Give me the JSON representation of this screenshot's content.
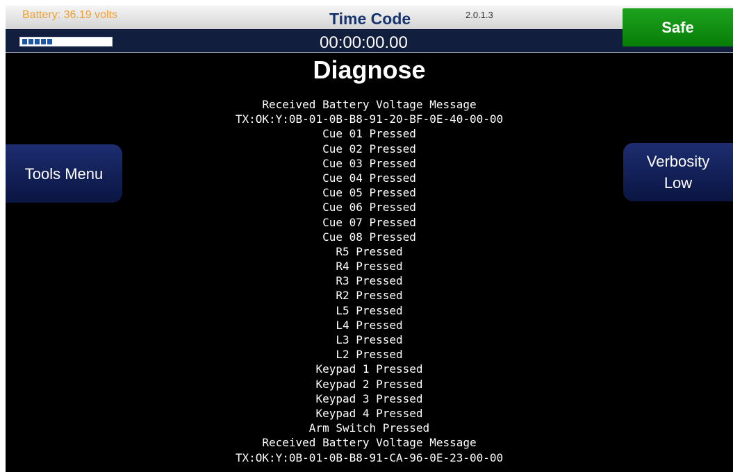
{
  "header": {
    "battery_text": "Battery: 36.19 volts",
    "battery_level": 0.38,
    "timecode_label": "Time Code",
    "version": "2.0.1.3",
    "timecode_value": "00:00:00.00",
    "safe_label": "Safe"
  },
  "page": {
    "title": "Diagnose"
  },
  "buttons": {
    "tools_menu": "Tools Menu",
    "verbosity_line1": "Verbosity",
    "verbosity_line2": "Low"
  },
  "log": [
    "Received Battery Voltage Message",
    "TX:OK:Y:0B-01-0B-B8-91-20-BF-0E-40-00-00",
    "Cue 01 Pressed",
    "Cue 02 Pressed",
    "Cue 03 Pressed",
    "Cue 04 Pressed",
    "Cue 05 Pressed",
    "Cue 06 Pressed",
    "Cue 07 Pressed",
    "Cue 08 Pressed",
    "R5 Pressed",
    "R4 Pressed",
    "R3 Pressed",
    "R2 Pressed",
    "L5 Pressed",
    "L4 Pressed",
    "L3 Pressed",
    "L2 Pressed",
    "Keypad 1 Pressed",
    "Keypad 2 Pressed",
    "Keypad 3 Pressed",
    "Keypad 4 Pressed",
    "Arm Switch Pressed",
    "Received Battery Voltage Message",
    "TX:OK:Y:0B-01-0B-B8-91-CA-96-0E-23-00-00"
  ],
  "colors": {
    "battery_text": "#f0a030",
    "safe_green": "#0f8f0f",
    "button_blue": "#13215a",
    "header_navy": "#121e3e"
  }
}
